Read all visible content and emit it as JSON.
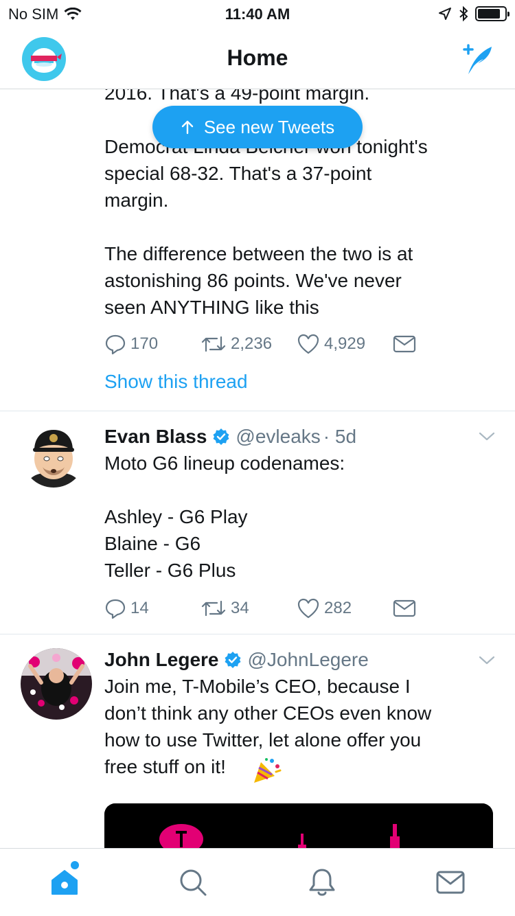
{
  "status_bar": {
    "carrier": "No SIM",
    "time": "11:40 AM"
  },
  "nav": {
    "title": "Home"
  },
  "new_tweets_pill": {
    "label": "See new Tweets"
  },
  "tweet1": {
    "partial_top": "2016. That's a 49-point margin.",
    "text": "Democrat Linda Belcher won tonight's\nspecial 68-32. That's a 37-point\nmargin.\n\nThe difference between the two is at\nastonishing 86 points. We've never\nseen ANYTHING like this",
    "replies": "170",
    "retweets": "2,236",
    "likes": "4,929",
    "show_thread": "Show this thread"
  },
  "tweet2": {
    "author": "Evan Blass",
    "handle": "@evleaks",
    "time": "· 5d",
    "text": "Moto G6 lineup codenames:\n\nAshley - G6 Play\nBlaine - G6\nTeller - G6 Plus",
    "replies": "14",
    "retweets": "34",
    "likes": "282"
  },
  "tweet3": {
    "author": "John Legere",
    "handle": "@JohnLegere",
    "text": "Join me, T-Mobile’s CEO, because I\ndon’t think any other CEOs even know\nhow to use Twitter, let alone offer you\nfree stuff on it!",
    "emoji": "party-popper-icon"
  },
  "colors": {
    "accent": "#1da1f2",
    "secondary_text": "#657786",
    "tmobile_magenta": "#e20074"
  }
}
